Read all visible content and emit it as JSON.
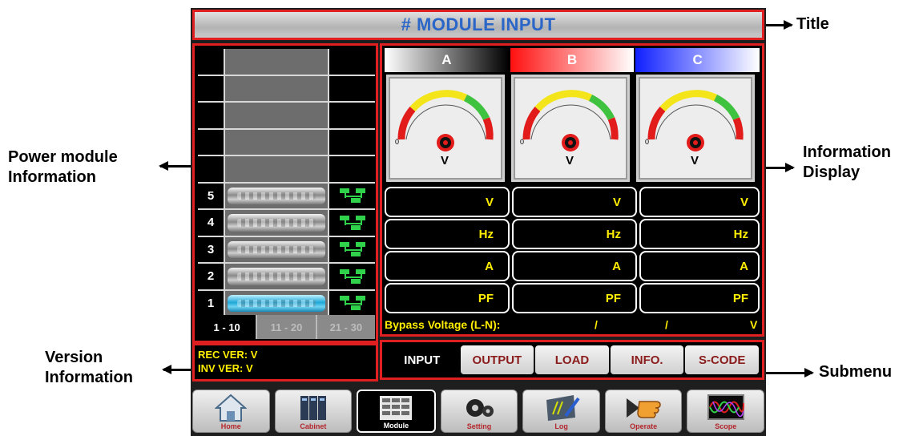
{
  "title": "# MODULE INPUT",
  "annotations": {
    "title": "Title",
    "power_module": [
      "Power module",
      "Information"
    ],
    "information_display": [
      "Information",
      "Display"
    ],
    "version": [
      "Version",
      "Information"
    ],
    "submenu": "Submenu"
  },
  "modules": {
    "rows": [
      {
        "number": "",
        "state": "empty"
      },
      {
        "number": "",
        "state": "empty"
      },
      {
        "number": "",
        "state": "empty"
      },
      {
        "number": "",
        "state": "empty"
      },
      {
        "number": "",
        "state": "empty"
      },
      {
        "number": "5",
        "state": "off"
      },
      {
        "number": "4",
        "state": "off"
      },
      {
        "number": "3",
        "state": "off"
      },
      {
        "number": "2",
        "state": "off"
      },
      {
        "number": "1",
        "state": "on"
      }
    ],
    "page_tabs": [
      "1 - 10",
      "11 - 20",
      "21 - 30"
    ],
    "selected_page": "1 - 10"
  },
  "version": {
    "rec": "REC VER: V",
    "inv": "INV VER: V"
  },
  "phases": {
    "labels": [
      "A",
      "B",
      "C"
    ],
    "gauge_zero": "0",
    "gauge_unit": "V"
  },
  "measurements": [
    [
      "V",
      "V",
      "V"
    ],
    [
      "Hz",
      "Hz",
      "Hz"
    ],
    [
      "A",
      "A",
      "A"
    ],
    [
      "PF",
      "PF",
      "PF"
    ]
  ],
  "bypass": {
    "label": "Bypass Voltage (L-N):",
    "sep1": "/",
    "sep2": "/",
    "unit": "V"
  },
  "submenu": {
    "items": [
      "INPUT",
      "OUTPUT",
      "LOAD",
      "INFO.",
      "S-CODE"
    ],
    "selected": "INPUT"
  },
  "nav": {
    "items": [
      "Home",
      "Cabinet",
      "Module",
      "Setting",
      "Log",
      "Operate",
      "Scope"
    ],
    "selected": "Module"
  },
  "colors": {
    "frame_red": "#e02020",
    "title_blue": "#2a66c8",
    "value_yellow": "#ffee00",
    "status_green": "#2fd24a",
    "module_on_blue": "#1ea8d8"
  }
}
